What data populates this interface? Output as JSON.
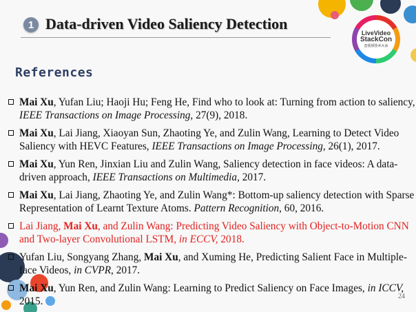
{
  "header": {
    "number": "1",
    "title": "Data-driven Video Saliency Detection"
  },
  "logo": {
    "line1": "LiveVideo",
    "line2": "StackCon",
    "line3": "音视频技术大会"
  },
  "references_heading": "References",
  "references": [
    {
      "highlight": false,
      "segments": [
        {
          "text": "Mai Xu",
          "style": "bold"
        },
        {
          "text": ", Yufan Liu; Haoji Hu; Feng He, Find who to look at: Turning from action to saliency, ",
          "style": "normal"
        },
        {
          "text": "IEEE Transactions on Image Processing",
          "style": "italic"
        },
        {
          "text": ", 27(9), 2018.",
          "style": "normal"
        }
      ]
    },
    {
      "highlight": false,
      "segments": [
        {
          "text": "Mai Xu",
          "style": "bold"
        },
        {
          "text": ", Lai Jiang, Xiaoyan Sun, Zhaoting Ye, and Zulin Wang, Learning to Detect Video Saliency with HEVC Features, ",
          "style": "normal"
        },
        {
          "text": "IEEE Transactions on Image Processing",
          "style": "italic"
        },
        {
          "text": ", 26(1), 2017.",
          "style": "normal"
        }
      ]
    },
    {
      "highlight": false,
      "segments": [
        {
          "text": "Mai Xu",
          "style": "bold"
        },
        {
          "text": ", Yun Ren, Jinxian Liu and Zulin Wang, Saliency detection in face videos: A data-driven approach, ",
          "style": "normal"
        },
        {
          "text": "IEEE Transactions on Multimedia",
          "style": "italic"
        },
        {
          "text": ", 2017.",
          "style": "normal"
        }
      ]
    },
    {
      "highlight": false,
      "segments": [
        {
          "text": "Mai Xu",
          "style": "bold"
        },
        {
          "text": ", Lai Jiang, Zhaoting Ye, and Zulin Wang*: Bottom-up saliency detection with Sparse Representation of Learnt Texture Atoms. ",
          "style": "normal"
        },
        {
          "text": "Pattern Recognition",
          "style": "italic"
        },
        {
          "text": ", 60, 2016.",
          "style": "normal"
        }
      ]
    },
    {
      "highlight": true,
      "segments": [
        {
          "text": "Lai Jiang, ",
          "style": "normal"
        },
        {
          "text": "Mai Xu",
          "style": "bold"
        },
        {
          "text": ", and Zulin Wang: Predicting Video Saliency with Object-to-Motion CNN and Two-layer Convolutional LSTM, ",
          "style": "normal"
        },
        {
          "text": "in ECCV,",
          "style": "italic"
        },
        {
          "text": " 2018.",
          "style": "normal"
        }
      ]
    },
    {
      "highlight": false,
      "segments": [
        {
          "text": "Yufan Liu, Songyang Zhang, ",
          "style": "normal"
        },
        {
          "text": "Mai Xu",
          "style": "bold"
        },
        {
          "text": ", and Xuming He, Predicting Salient Face in Multiple-face Videos, ",
          "style": "normal"
        },
        {
          "text": "in CVPR,",
          "style": "italic"
        },
        {
          "text": " 2017.",
          "style": "normal"
        }
      ]
    },
    {
      "highlight": false,
      "segments": [
        {
          "text": "Mai Xu",
          "style": "bold"
        },
        {
          "text": ", Yun Ren, and Zulin Wang: Learning to Predict Saliency on Face Images, ",
          "style": "normal"
        },
        {
          "text": "in ICCV,",
          "style": "italic"
        },
        {
          "text": " 2015.",
          "style": "normal"
        }
      ]
    }
  ],
  "page_number": "24",
  "colors": {
    "highlight_text": "#e0211f",
    "heading": "#2d3e63",
    "badge": "#7a8aa0"
  }
}
